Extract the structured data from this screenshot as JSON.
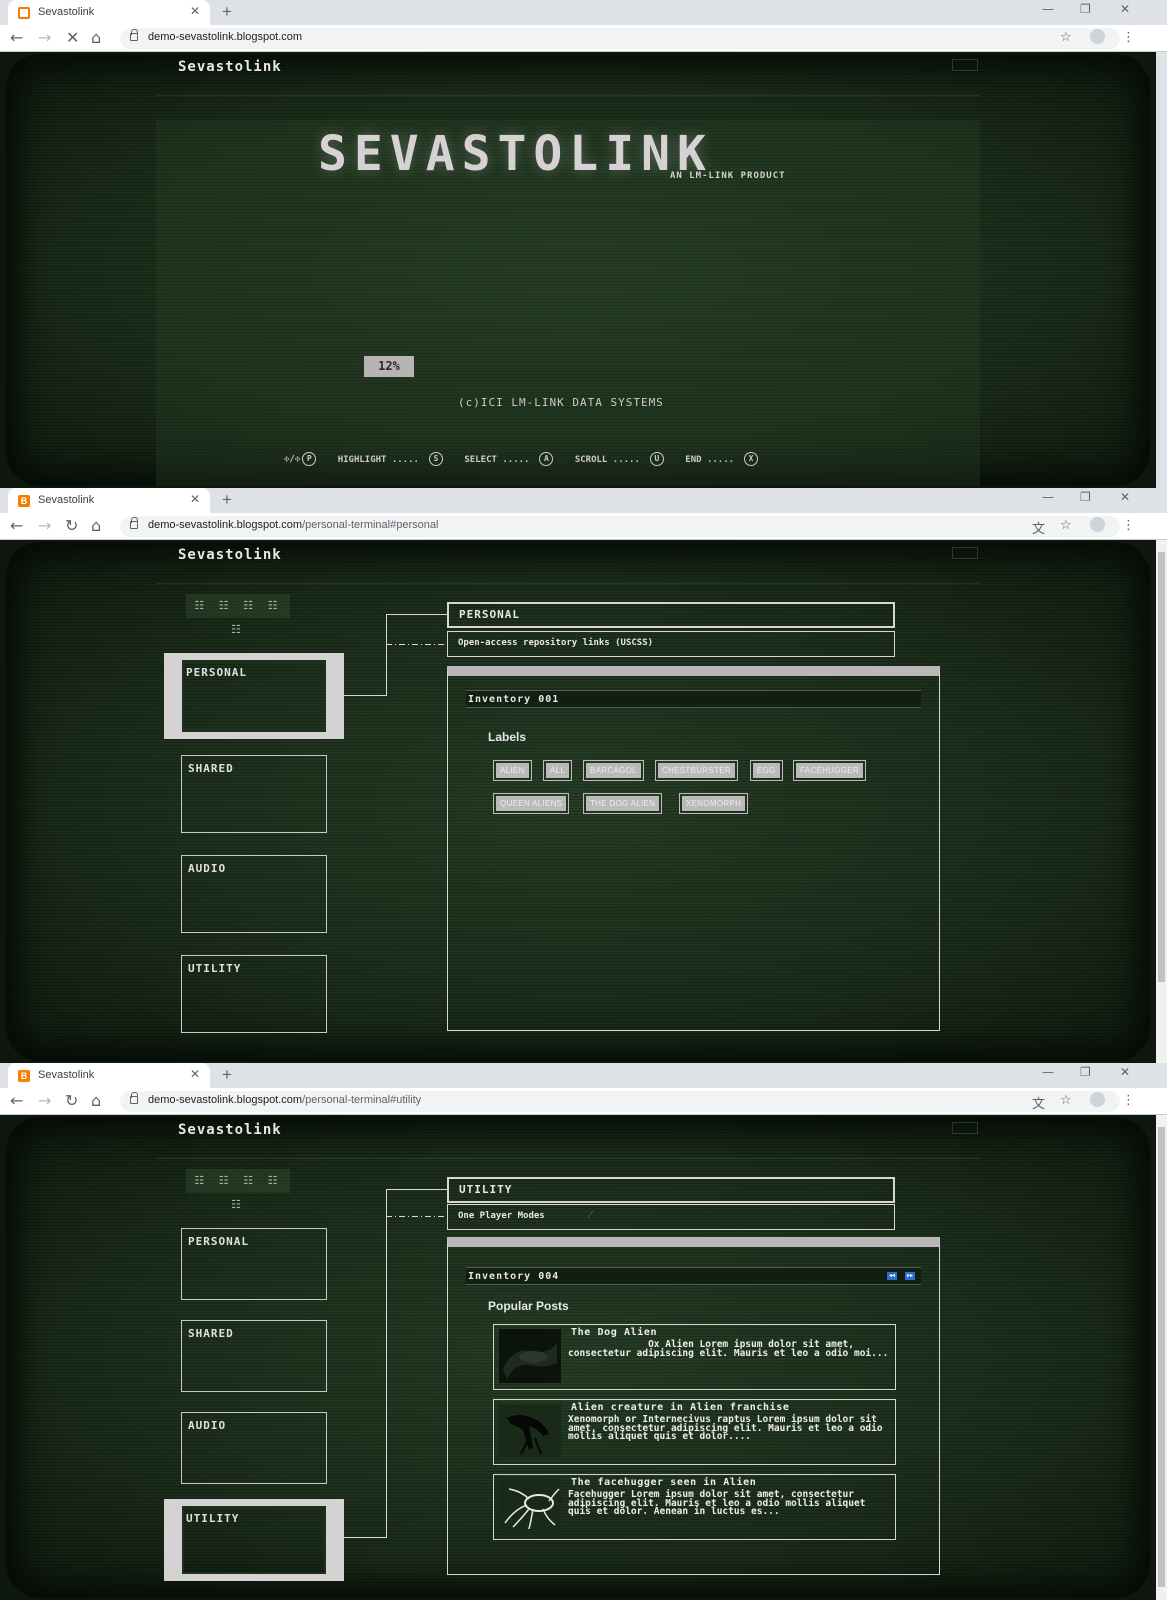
{
  "browser": {
    "tab_title": "Sevastolink",
    "url_host": "demo-sevastolink.blogspot.com",
    "shot2_path": "/personal-terminal#personal",
    "shot3_path": "/personal-terminal#utility"
  },
  "site": {
    "title": "Sevastolink"
  },
  "boot": {
    "logo": "SEVASTOLINK",
    "tagline": "AN LM-LINK PRODUCT",
    "progress": "12%",
    "copyright": "(c)ICI LM-LINK DATA SYSTEMS",
    "controls": {
      "move": "✣/✣",
      "move_key": "P",
      "highlight": "HIGHLIGHT .....",
      "highlight_key": "S",
      "select": "SELECT .....",
      "select_key": "A",
      "scroll": "SCROLL .....",
      "scroll_key": "U",
      "end": "END .....",
      "end_key": "X"
    }
  },
  "terminal": {
    "tabnav": "☷ ☷ ☷ ☷ ☷",
    "menu": [
      "PERSONAL",
      "SHARED",
      "AUDIO",
      "UTILITY"
    ]
  },
  "personal": {
    "title": "PERSONAL",
    "description": "Open-access repository links (USCSS)",
    "inventory": "Inventory 001",
    "section": "Labels",
    "labels": [
      "ALIEN",
      "ALL",
      "BARCAGOL",
      "CHESTBURSTER",
      "EGG",
      "FACEHUGGER",
      "QUEEN ALIENS",
      "THE DOG ALIEN",
      "XENOMORPH"
    ]
  },
  "utility": {
    "title": "UTILITY",
    "description": "One Player Modes",
    "inventory": "Inventory 004",
    "section": "Popular Posts",
    "posts": [
      {
        "title": "The Dog Alien",
        "snippet": "              Ox Alien Lorem ipsum dolor sit amet, consectetur adipiscing elit. Mauris et leo a odio moi..."
      },
      {
        "title": "Alien creature in Alien franchise",
        "snippet": "Xenomorph or Internecivus raptus Lorem ipsum dolor sit amet, consectetur adipiscing elit. Mauris et leo a odio mollis aliquet quis et dolor...."
      },
      {
        "title": "The facehugger seen in Alien",
        "snippet": "Facehugger Lorem ipsum dolor sit amet, consectetur adipiscing elit. Mauris et leo a odio mollis aliquet quis et dolor. Aenean in luctus es..."
      }
    ]
  }
}
